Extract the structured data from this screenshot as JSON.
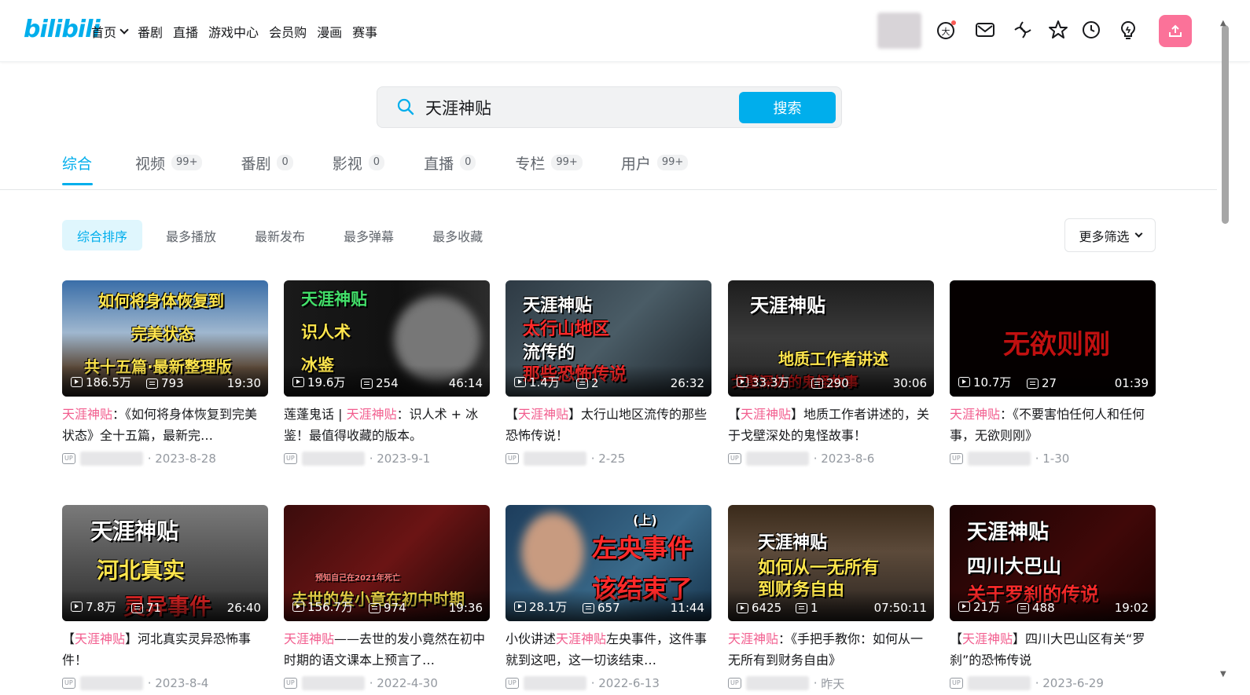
{
  "header": {
    "logo": "bilibili",
    "nav": [
      {
        "label": "首页",
        "dropdown": true
      },
      {
        "label": "番剧"
      },
      {
        "label": "直播"
      },
      {
        "label": "游戏中心"
      },
      {
        "label": "会员购"
      },
      {
        "label": "漫画"
      },
      {
        "label": "赛事"
      }
    ],
    "icons": [
      "vip-icon",
      "message-icon",
      "dynamic-icon",
      "favorite-icon",
      "history-icon",
      "creation-icon",
      "upload-icon"
    ],
    "accent": "#00aeec",
    "pink": "#fb7299"
  },
  "search": {
    "query": "天涯神贴",
    "button": "搜索"
  },
  "tabs": [
    {
      "label": "综合",
      "count": "",
      "active": true
    },
    {
      "label": "视频",
      "count": "99+"
    },
    {
      "label": "番剧",
      "count": "0"
    },
    {
      "label": "影视",
      "count": "0"
    },
    {
      "label": "直播",
      "count": "0"
    },
    {
      "label": "专栏",
      "count": "99+"
    },
    {
      "label": "用户",
      "count": "99+"
    }
  ],
  "sort": {
    "options": [
      "综合排序",
      "最多播放",
      "最新发布",
      "最多弹幕",
      "最多收藏"
    ],
    "active": 0,
    "more_filter": "更多筛选"
  },
  "videos": [
    {
      "views": "186.5万",
      "danmaku": "793",
      "duration": "19:30",
      "title_hl": "天涯神贴",
      "title_pre": "",
      "title_post": "：《如何将身体恢复到完美状态》全十五篇，最新完…",
      "date": "2023-8-28",
      "thumb_lines": [
        "如何将身体恢复到",
        "完美状态",
        "共十五篇·最新整理版"
      ]
    },
    {
      "views": "19.6万",
      "danmaku": "254",
      "duration": "46:14",
      "title_hl": "天涯神贴",
      "title_pre": "莲蓬鬼话 | ",
      "title_post": "：识人术 + 冰鉴！最值得收藏的版本。",
      "date": "2023-9-1",
      "thumb_lines": [
        "天涯神贴",
        "识人术",
        "冰鉴"
      ]
    },
    {
      "views": "1.4万",
      "danmaku": "2",
      "duration": "26:32",
      "title_hl": "天涯神贴",
      "title_pre": "【",
      "title_post": "】太行山地区流传的那些恐怖传说！",
      "date": "2-25",
      "thumb_lines": [
        "天涯神贴",
        "太行山地区",
        "流传的",
        "那些恐怖传说"
      ]
    },
    {
      "views": "33.3万",
      "danmaku": "290",
      "duration": "30:06",
      "title_hl": "天涯神贴",
      "title_pre": "【",
      "title_post": "】地质工作者讲述的，关于戈壁深处的鬼怪故事！",
      "date": "2023-8-6",
      "thumb_lines": [
        "天涯神贴",
        "地质工作者讲述",
        "戈壁深处的鬼怪故事"
      ]
    },
    {
      "views": "10.7万",
      "danmaku": "27",
      "duration": "01:39",
      "title_hl": "天涯神贴",
      "title_pre": "",
      "title_post": "：《不要害怕任何人和任何事，无欲则刚》",
      "date": "1-30",
      "thumb_lines": [
        "无欲则刚"
      ]
    },
    {
      "views": "7.8万",
      "danmaku": "71",
      "duration": "26:40",
      "title_hl": "天涯神贴",
      "title_pre": "【",
      "title_post": "】河北真实灵异恐怖事件！",
      "date": "2023-8-4",
      "thumb_lines": [
        "天涯神贴",
        "河北真实",
        "灵异事件"
      ]
    },
    {
      "views": "156.7万",
      "danmaku": "974",
      "duration": "19:36",
      "title_hl": "天涯神贴",
      "title_pre": "",
      "title_post": "——去世的发小竟然在初中时期的语文课本上预言了…",
      "date": "2022-4-30",
      "thumb_lines": [
        "去世的发小竟在初中时期",
        "预知自己在2021年死亡"
      ]
    },
    {
      "views": "28.1万",
      "danmaku": "657",
      "duration": "11:44",
      "title_hl": "天涯神贴",
      "title_pre": "小伙讲述",
      "title_post": "左央事件，这件事就到这吧，这一切该结束…",
      "date": "2022-6-13",
      "thumb_lines": [
        "(上)",
        "左央事件",
        "该结束了"
      ]
    },
    {
      "views": "6425",
      "danmaku": "1",
      "duration": "07:50:11",
      "title_hl": "天涯神贴",
      "title_pre": "",
      "title_post": "：《手把手教你：如何从一无所有到财务自由》",
      "date": "昨天",
      "thumb_lines": [
        "天涯神贴",
        "如何从一无所有",
        "到财务自由"
      ]
    },
    {
      "views": "21万",
      "danmaku": "488",
      "duration": "19:02",
      "title_hl": "天涯神贴",
      "title_pre": "【",
      "title_post": "】四川大巴山区有关“罗刹”的恐怖传说",
      "date": "2023-6-29",
      "thumb_lines": [
        "天涯神贴",
        "四川大巴山",
        "关于罗刹的传说"
      ]
    }
  ]
}
